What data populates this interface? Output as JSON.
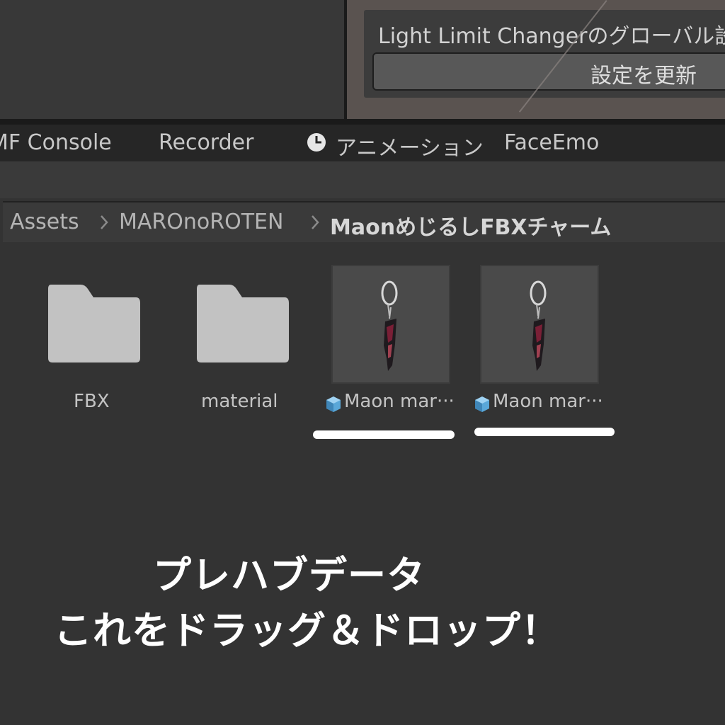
{
  "inspector": {
    "title": "Light Limit Changerのグローバル設",
    "update_button": "設定を更新"
  },
  "tabs": [
    {
      "label": "MF Console"
    },
    {
      "label": "Recorder"
    },
    {
      "label": "アニメーション",
      "icon": "clock-icon"
    },
    {
      "label": "FaceEmo"
    }
  ],
  "breadcrumb": [
    "Assets",
    "MAROnoROTEN",
    "MaonめじるしFBXチャーム"
  ],
  "assets": [
    {
      "type": "folder",
      "label": "FBX"
    },
    {
      "type": "folder",
      "label": "material"
    },
    {
      "type": "prefab",
      "label": "Maon mar···",
      "icon": "prefab-cube-icon"
    },
    {
      "type": "prefab",
      "label": "Maon mar···",
      "icon": "prefab-cube-icon"
    }
  ],
  "caption": {
    "line1": "プレハブデータ",
    "line2": "これをドラッグ＆ドロップ！"
  },
  "colors": {
    "panel_bg": "#333333",
    "tab_bg": "#262626",
    "inspector_bg": "#5a5350",
    "caption_text": "#ffffff",
    "folder_icon": "#c2c2c2"
  }
}
